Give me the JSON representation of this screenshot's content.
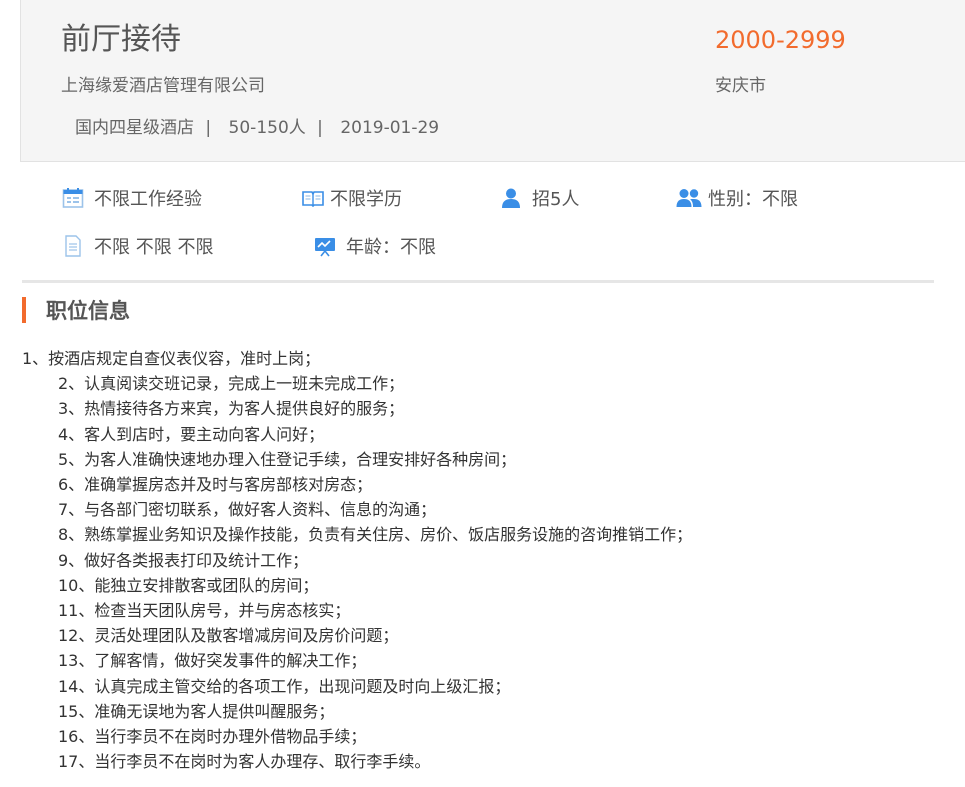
{
  "header": {
    "title": "前厅接待",
    "company": "上海缘爱酒店管理有限公司",
    "company_type": "国内四星级酒店",
    "company_size": "50-150人",
    "post_date": "2019-01-29",
    "separator": "|",
    "salary": "2000-2999",
    "city": "安庆市"
  },
  "attributes": [
    {
      "icon": "calendar-icon",
      "text": "不限工作经验"
    },
    {
      "icon": "book-icon",
      "text": "不限学历"
    },
    {
      "icon": "person-icon",
      "text": "招5人"
    },
    {
      "icon": "people-icon",
      "text": "性别：不限"
    },
    {
      "icon": "document-icon",
      "text": "不限 不限 不限"
    },
    {
      "icon": "presentation-icon",
      "text": "年龄：不限"
    }
  ],
  "colors": {
    "accent": "#f26b2d",
    "icon_blue": "#3a8ee6",
    "icon_light": "#9cc3ea"
  },
  "section": {
    "title": "职位信息"
  },
  "duties": [
    "1、按酒店规定自查仪表仪容，准时上岗；",
    "2、认真阅读交班记录，完成上一班未完成工作；",
    "3、热情接待各方来宾，为客人提供良好的服务；",
    "4、客人到店时，要主动向客人问好；",
    "5、为客人准确快速地办理入住登记手续，合理安排好各种房间；",
    "6、准确掌握房态并及时与客房部核对房态；",
    "7、与各部门密切联系，做好客人资料、信息的沟通；",
    "8、熟练掌握业务知识及操作技能，负责有关住房、房价、饭店服务设施的咨询推销工作；",
    "9、做好各类报表打印及统计工作；",
    "10、能独立安排散客或团队的房间；",
    "11、检查当天团队房号，并与房态核实；",
    "12、灵活处理团队及散客增减房间及房价问题；",
    "13、了解客情，做好突发事件的解决工作；",
    "14、认真完成主管交给的各项工作，出现问题及时向上级汇报；",
    "15、准确无误地为客人提供叫醒服务；",
    "16、当行李员不在岗时办理外借物品手续；",
    "17、当行李员不在岗时为客人办理存、取行李手续。"
  ]
}
